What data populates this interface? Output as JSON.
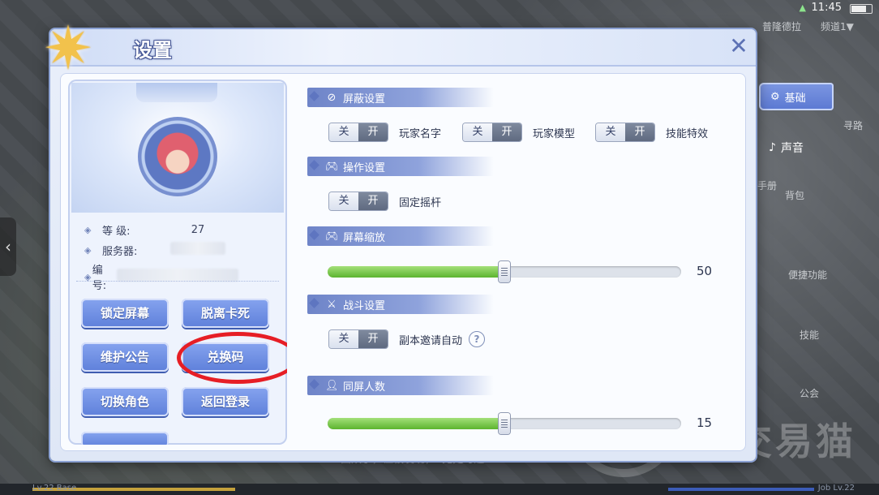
{
  "status_bar": {
    "time": "11:45",
    "wifi": "wifi"
  },
  "background": {
    "labels": [
      "普隆德拉",
      "频道1▼",
      "寻路",
      "背包",
      "手册",
      "便捷功能",
      "技能",
      "公会"
    ],
    "bottom_text": "曲双了，但被发现，1无处可逃",
    "watermark": "交易猫",
    "level_left": "Lv.22 Base",
    "level_right": "Job Lv.22"
  },
  "side_tabs": {
    "basic": "基础",
    "sound": "声音"
  },
  "dialog": {
    "title": "设置",
    "close_icon": "close-x-icon"
  },
  "profile": {
    "level_label": "等  级:",
    "level_value": "27",
    "server_label": "服务器:",
    "id_label": "编  号:",
    "buttons": {
      "lock_screen": "锁定屏幕",
      "unstuck": "脱离卡死",
      "maintenance": "维护公告",
      "redeem_code": "兑换码",
      "switch_role": "切换角色",
      "back_login": "返回登录"
    }
  },
  "settings": {
    "shield": {
      "title": "屏蔽设置",
      "off_label": "关",
      "on_label": "开",
      "items": [
        {
          "label": "玩家名字",
          "state": "on"
        },
        {
          "label": "玩家模型",
          "state": "on"
        },
        {
          "label": "技能特效",
          "state": "on"
        }
      ]
    },
    "controls": {
      "title": "操作设置",
      "off_label": "关",
      "on_label": "开",
      "fixed_joystick": {
        "label": "固定摇杆",
        "state": "on"
      }
    },
    "screen_zoom": {
      "title": "屏幕缩放",
      "value": "50",
      "fill_percent": 50
    },
    "battle": {
      "title": "战斗设置",
      "off_label": "关",
      "on_label": "开",
      "dungeon_invite": {
        "label": "副本邀请自动",
        "state": "on"
      },
      "help": "?"
    },
    "players_on_screen": {
      "title": "同屏人数",
      "value": "15",
      "fill_percent": 50
    }
  },
  "colors": {
    "accent_blue": "#5e80da",
    "slider_green": "#5cb42f",
    "highlight_red": "#e61e25"
  }
}
